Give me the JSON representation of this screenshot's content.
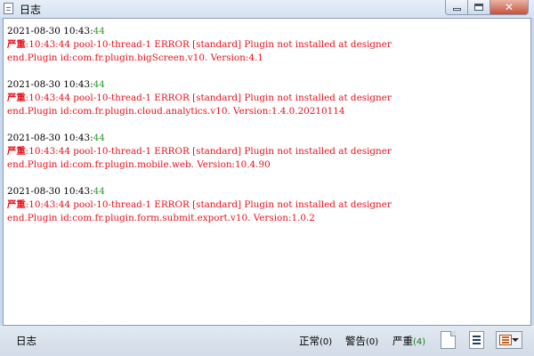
{
  "window": {
    "title": "日志",
    "icon": "log-document-icon",
    "controls": [
      "minimize-icon",
      "maximize-icon",
      "close-icon"
    ]
  },
  "log_entries": [
    {
      "timestamp": "2021-08-30 10:43:",
      "seconds": "44",
      "severity": "严重",
      "message_line1": ":10:43:44 pool-10-thread-1 ERROR [standard] Plugin not installed at designer",
      "message_line2": "end.Plugin id:com.fr.plugin.bigScreen.v10. Version:4.1"
    },
    {
      "timestamp": "2021-08-30 10:43:",
      "seconds": "44",
      "severity": "严重",
      "message_line1": ":10:43:44 pool-10-thread-1 ERROR [standard] Plugin not installed at designer",
      "message_line2": "end.Plugin id:com.fr.plugin.cloud.analytics.v10. Version:1.4.0.20210114"
    },
    {
      "timestamp": "2021-08-30 10:43:",
      "seconds": "44",
      "severity": "严重",
      "message_line1": ":10:43:44 pool-10-thread-1 ERROR [standard] Plugin not installed at designer",
      "message_line2": "end.Plugin id:com.fr.plugin.mobile.web. Version:10.4.90"
    },
    {
      "timestamp": "2021-08-30 10:43:",
      "seconds": "44",
      "severity": "严重",
      "message_line1": ":10:43:44 pool-10-thread-1 ERROR [standard] Plugin not installed at designer",
      "message_line2": "end.Plugin id:com.fr.plugin.form.submit.export.v10. Version:1.0.2"
    }
  ],
  "status_bar": {
    "label": "日志",
    "normal_label": "正常",
    "normal_count": "(0)",
    "warning_label": "警告",
    "warning_count": "(0)",
    "severe_label": "严重",
    "severe_count": "(4)",
    "tools": [
      "clear-log-icon",
      "view-document-icon",
      "filter-list-dropdown-icon"
    ]
  },
  "colors": {
    "error_text": "#e8111b",
    "seconds_text": "#2e9a2e",
    "severe_count": "#1a7a1a"
  }
}
